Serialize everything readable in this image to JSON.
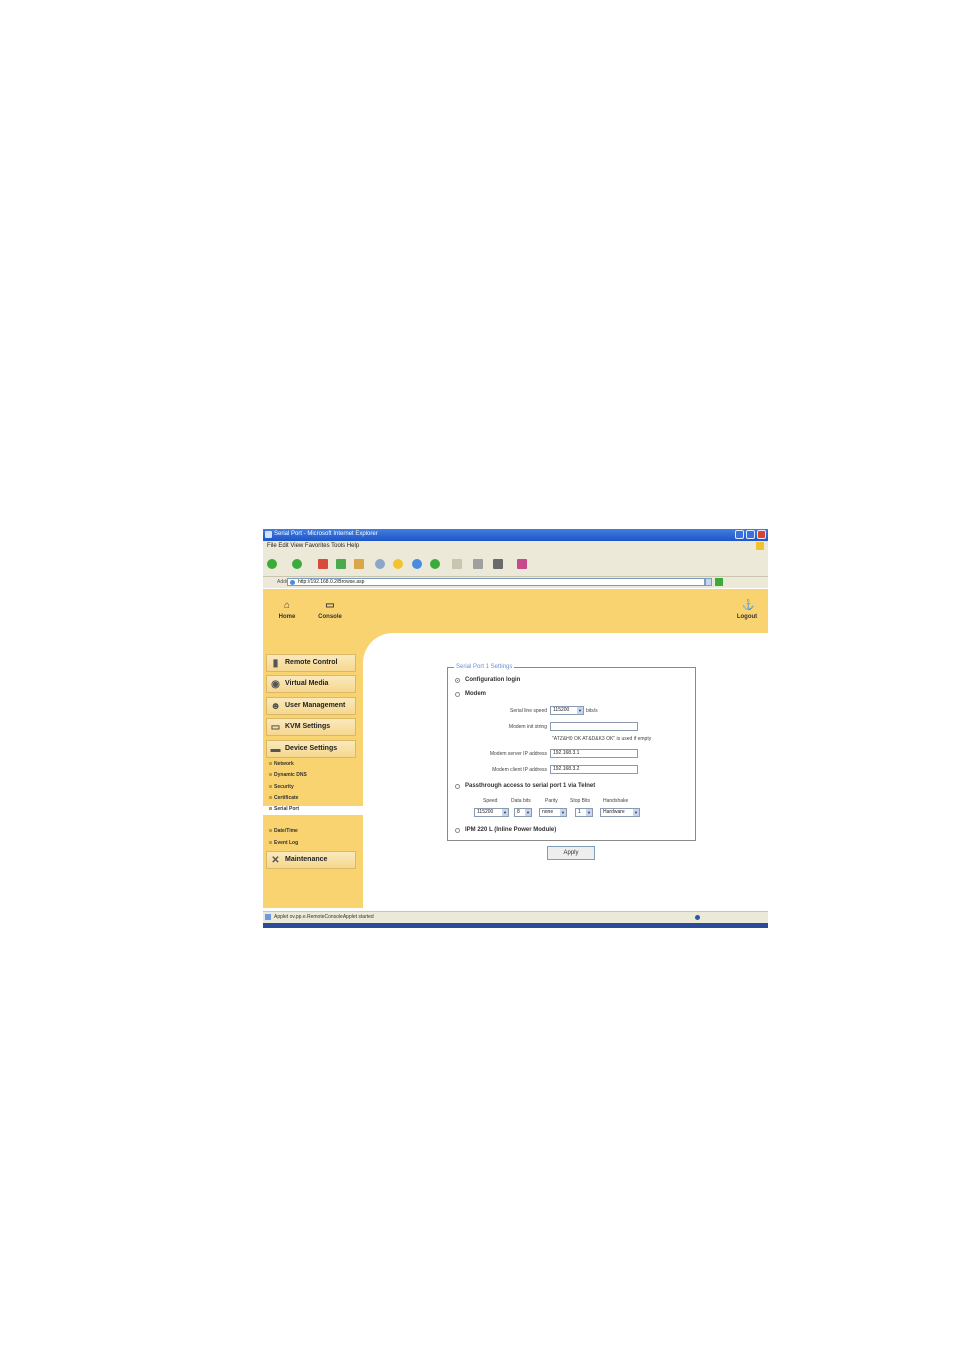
{
  "window": {
    "title": "Serial Port - Microsoft Internet Explorer",
    "menu": "File  Edit  View  Favorites  Tools  Help"
  },
  "addressbar": {
    "label": "Address",
    "url": "http://192.168.0.2/Browse.asp"
  },
  "header": {
    "home": "Home",
    "console": "Console",
    "logout": "Logout"
  },
  "sidebar": {
    "items": [
      {
        "label": "Remote Control",
        "icon": "remote-control-icon"
      },
      {
        "label": "Virtual Media",
        "icon": "virtual-media-icon"
      },
      {
        "label": "User Management",
        "icon": "user-management-icon"
      },
      {
        "label": "KVM Settings",
        "icon": "kvm-settings-icon"
      },
      {
        "label": "Device Settings",
        "icon": "device-settings-icon"
      }
    ],
    "subitems": [
      "Network",
      "Dynamic DNS",
      "Security",
      "Certificate",
      "Serial Port",
      "Date/Time",
      "Event Log"
    ],
    "maintenance": "Maintenance"
  },
  "settings": {
    "legend": "Serial Port 1 Settings",
    "config_login": "Configuration login",
    "modem": "Modem",
    "serial_speed_label": "Serial line speed",
    "serial_speed_value": "115200",
    "serial_speed_unit": "bits/s",
    "modem_init_label": "Modem init string",
    "modem_init_value": "",
    "modem_init_hint": "\"ATZ&H0 OK AT&D&K3 OK\" is used if empty",
    "server_ip_label": "Modem server IP address",
    "server_ip_value": "192.168.3.1",
    "client_ip_label": "Modem client IP address",
    "client_ip_value": "192.168.3.2",
    "passthrough": "Passthrough access to serial port 1 via Telnet",
    "columns": [
      "Speed",
      "Data bits",
      "Parity",
      "Stop Bits",
      "Handshake"
    ],
    "values": [
      "115200",
      "8",
      "none",
      "1",
      "Hardware"
    ],
    "ipm": "IPM 220 L (Inline Power Module)"
  },
  "apply_label": "Apply",
  "status": {
    "text": "Applet ov.pp.e.RemoteConsoleApplet started"
  }
}
